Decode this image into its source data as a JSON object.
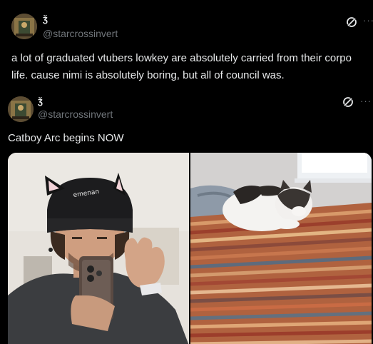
{
  "posts": [
    {
      "display_name": "ǯ",
      "handle": "@starcrossinvert",
      "text_line1": "a lot of graduated vtubers lowkey are absolutely carried from their corpo",
      "text_line2": "life. cause nimi is absolutely boring, but all of council was.",
      "more": "···"
    },
    {
      "display_name": "ǯ",
      "handle": "@starcrossinvert",
      "text": "Catboy Arc begins NOW",
      "more": "···",
      "images": [
        {
          "icon": "photo-person-cat-ear-beanie"
        },
        {
          "icon": "photo-cat-on-bed"
        }
      ]
    }
  ],
  "colors": {
    "background": "#000000",
    "text": "#e7e9ea",
    "secondary": "#71767b"
  }
}
